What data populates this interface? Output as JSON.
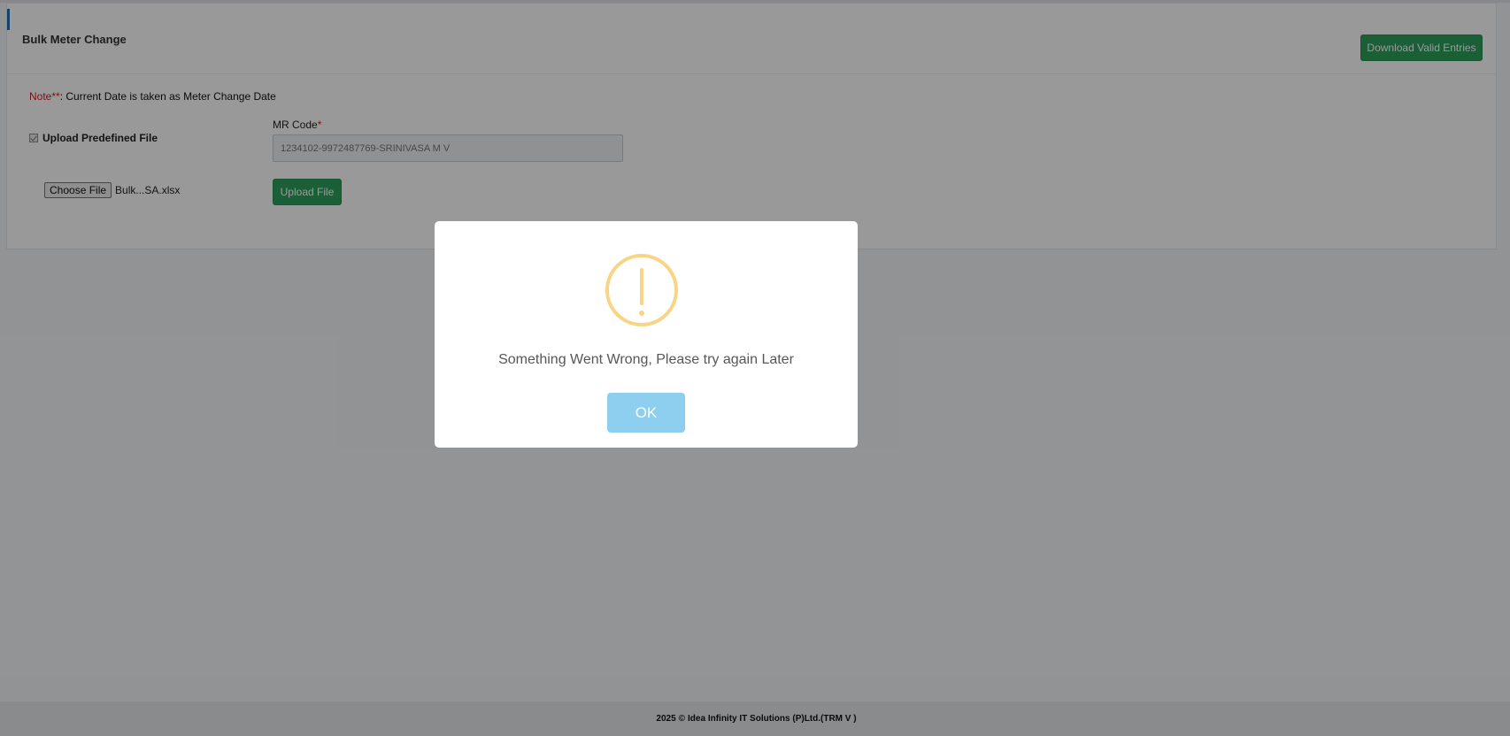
{
  "page": {
    "title": "Bulk Meter Change",
    "download_button": "Download Valid Entries",
    "note": {
      "prefix": "Note**",
      "text": ": Current Date is taken as Meter Change Date"
    },
    "upload_checkbox": {
      "label": "Upload Predefined File",
      "checked": true,
      "disabled": true
    },
    "mr_code": {
      "label": "MR Code",
      "required_mark": "*",
      "value": "1234102-9972487769-SRINIVASA M V"
    },
    "file_input": {
      "button_label": "Choose File",
      "file_name": "Bulk...SA.xlsx"
    },
    "upload_button": "Upload File"
  },
  "footer": {
    "year": "2025",
    "copyright_symbol": "©",
    "text": "Idea Infinity IT Solutions (P)Ltd.(TRM V )"
  },
  "modal": {
    "icon": "warning-icon",
    "message": "Something Went Wrong, Please try again Later",
    "ok_button": "OK"
  },
  "colors": {
    "accent_green": "#2e9e5b",
    "required_red": "#cc1f1f",
    "warning_yellow": "#f8d486",
    "ok_blue": "#8ecfef",
    "overlay": "rgba(0,0,0,0.4)"
  }
}
